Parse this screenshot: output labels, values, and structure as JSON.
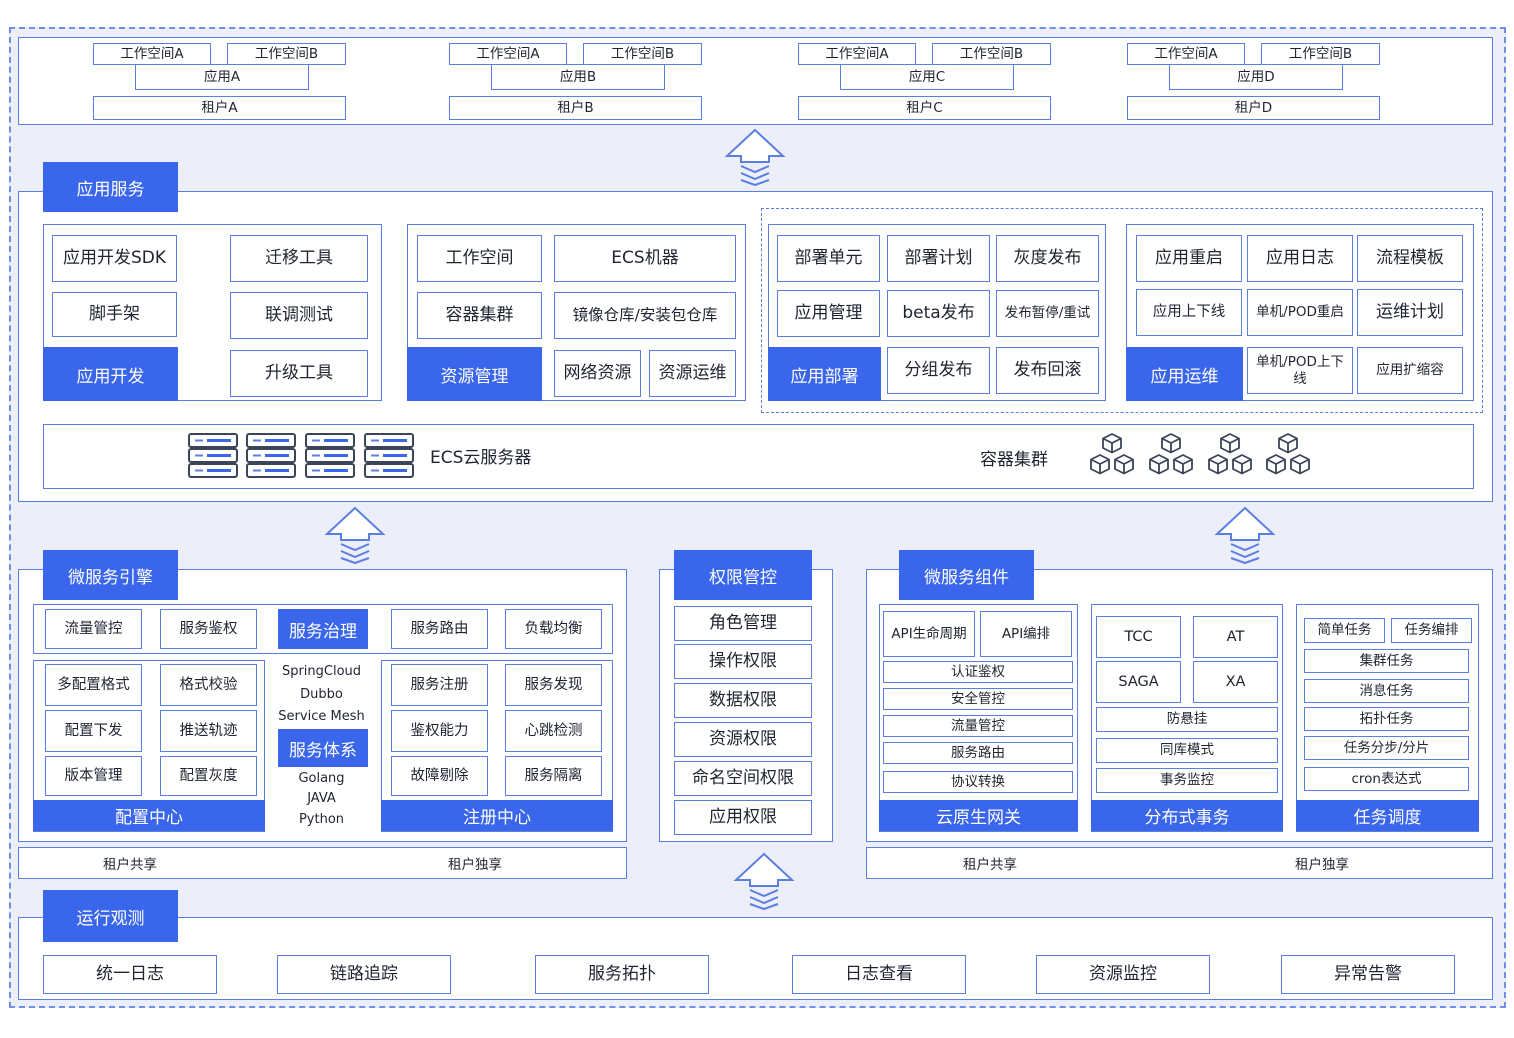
{
  "tenants": [
    {
      "ws_a": "工作空间A",
      "ws_b": "工作空间B",
      "app": "应用A",
      "tenant": "租户A"
    },
    {
      "ws_a": "工作空间A",
      "ws_b": "工作空间B",
      "app": "应用B",
      "tenant": "租户B"
    },
    {
      "ws_a": "工作空间A",
      "ws_b": "工作空间B",
      "app": "应用C",
      "tenant": "租户C"
    },
    {
      "ws_a": "工作空间A",
      "ws_b": "工作空间B",
      "app": "应用D",
      "tenant": "租户D"
    }
  ],
  "app_service": {
    "title": "应用服务",
    "dev": {
      "title": "应用开发",
      "items": [
        "应用开发SDK",
        "迁移工具",
        "脚手架",
        "联调测试",
        "升级工具"
      ]
    },
    "resource": {
      "title": "资源管理",
      "items": [
        "工作空间",
        "ECS机器",
        "容器集群",
        "镜像仓库/安装包仓库",
        "网络资源",
        "资源运维"
      ]
    },
    "deploy": {
      "title": "应用部署",
      "items": [
        "部署单元",
        "部署计划",
        "灰度发布",
        "应用管理",
        "beta发布",
        "发布暂停/重试",
        "分组发布",
        "发布回滚"
      ]
    },
    "ops": {
      "title": "应用运维",
      "items": [
        "应用重启",
        "应用日志",
        "流程模板",
        "应用上下线",
        "单机/POD重启",
        "运维计划",
        "单机/POD上下线",
        "应用扩缩容"
      ]
    },
    "infra": {
      "ecs": "ECS云服务器",
      "container": "容器集群"
    }
  },
  "ms_engine": {
    "title": "微服务引擎",
    "top_row": [
      "流量管控",
      "服务鉴权",
      "服务治理",
      "服务路由",
      "负载均衡"
    ],
    "config": {
      "title": "配置中心",
      "items": [
        "多配置格式",
        "格式校验",
        "配置下发",
        "推送轨迹",
        "版本管理",
        "配置灰度"
      ]
    },
    "frameworks_top": [
      "SpringCloud",
      "Dubbo",
      "Service Mesh"
    ],
    "system": "服务体系",
    "frameworks_bottom": [
      "Golang",
      "JAVA",
      "Python"
    ],
    "registry": {
      "title": "注册中心",
      "items": [
        "服务注册",
        "服务发现",
        "鉴权能力",
        "心跳检测",
        "故障剔除",
        "服务隔离"
      ]
    },
    "shared": "租户共享",
    "exclusive": "租户独享"
  },
  "permission": {
    "title": "权限管控",
    "items": [
      "角色管理",
      "操作权限",
      "数据权限",
      "资源权限",
      "命名空间权限",
      "应用权限"
    ]
  },
  "ms_components": {
    "title": "微服务组件",
    "gateway": {
      "title": "云原生网关",
      "top": [
        "API生命周期",
        "API编排"
      ],
      "items": [
        "认证鉴权",
        "安全管控",
        "流量管控",
        "服务路由",
        "协议转换"
      ]
    },
    "transaction": {
      "title": "分布式事务",
      "grid": [
        "TCC",
        "AT",
        "SAGA",
        "XA"
      ],
      "items": [
        "防悬挂",
        "同库模式",
        "事务监控"
      ]
    },
    "scheduling": {
      "title": "任务调度",
      "top": [
        "简单任务",
        "任务编排"
      ],
      "items": [
        "集群任务",
        "消息任务",
        "拓扑任务",
        "任务分步/分片",
        "cron表达式"
      ]
    },
    "shared": "租户共享",
    "exclusive": "租户独享"
  },
  "observability": {
    "title": "运行观测",
    "items": [
      "统一日志",
      "链路追踪",
      "服务拓扑",
      "日志查看",
      "资源监控",
      "异常告警"
    ]
  },
  "colors": {
    "accent": "#3a66eb",
    "border": "#5b7fe0",
    "background": "#eceff9"
  }
}
